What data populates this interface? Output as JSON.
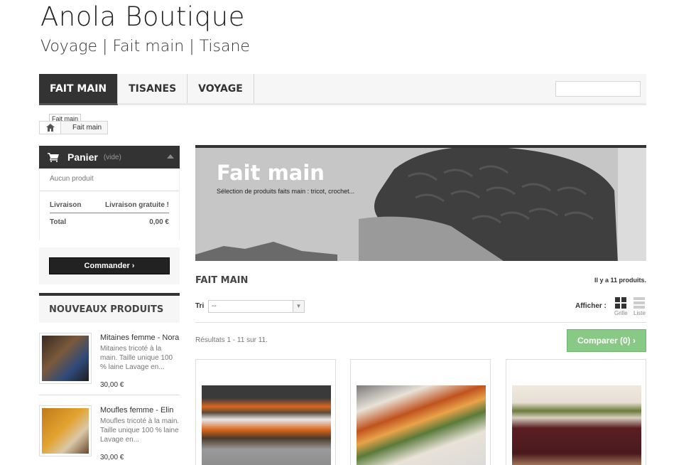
{
  "site": {
    "logo": "Anola Boutique",
    "tagline": "Voyage | Fait main | Tisane"
  },
  "nav": {
    "items": [
      "FAIT MAIN",
      "TISANES",
      "VOYAGE"
    ],
    "search_placeholder": ""
  },
  "breadcrumb": {
    "tooltip": "Fait main",
    "current": "Fait main"
  },
  "cart": {
    "title": "Panier",
    "status": "(vide)",
    "empty_text": "Aucun produit",
    "shipping_label": "Livraison",
    "shipping_value": "Livraison gratuite !",
    "total_label": "Total",
    "total_value": "0,00 €",
    "checkout_label": "Commander ›"
  },
  "new_products": {
    "title": "NOUVEAUX PRODUITS",
    "items": [
      {
        "name": "Mitaines femme - Nora",
        "desc": "Mitaines tricoté à la main.  Taille unique 100 % laine Lavage en...",
        "price": "30,00 €"
      },
      {
        "name": "Moufles femme - Elin",
        "desc": "Moufles tricoté à la main. Taille unique 100 % laine Lavage en...",
        "price": "30,00 €"
      }
    ]
  },
  "category": {
    "banner_title": "Fait main",
    "banner_subtitle": "Sélection de produits faits main : tricot, crochet...",
    "heading": "FAIT MAIN",
    "count": "Il y a 11 produits.",
    "sort_label": "Tri",
    "sort_value": "--",
    "view_label": "Afficher :",
    "view_grid": "Grille",
    "view_list": "Liste",
    "results": "Résultats 1 - 11 sur 11.",
    "compare_label": "Comparer (0) ›"
  },
  "colors": {
    "dark": "#333333",
    "compare_green": "#88c985",
    "light_bg": "#f6f6f6"
  }
}
